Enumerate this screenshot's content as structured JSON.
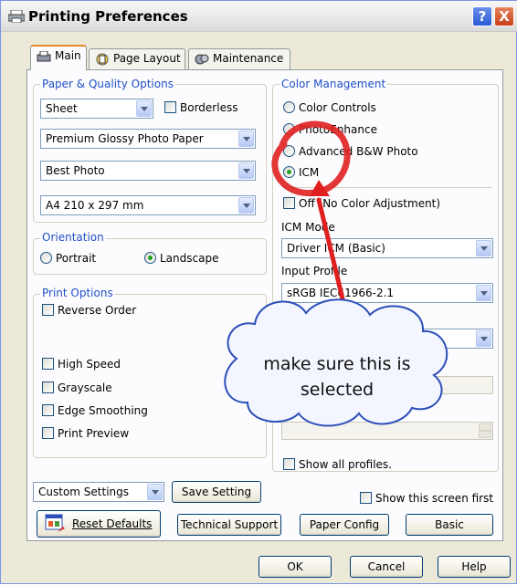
{
  "window": {
    "title": "Printing Preferences",
    "help_glyph": "?",
    "close_glyph": "X"
  },
  "tabs": [
    {
      "label": "Main",
      "icon": "printer-paper-icon",
      "active": true
    },
    {
      "label": "Page Layout",
      "icon": "page-layout-icon",
      "active": false
    },
    {
      "label": "Maintenance",
      "icon": "maintenance-icon",
      "active": false
    }
  ],
  "paper_quality": {
    "label": "Paper & Quality Options",
    "source": "Sheet",
    "borderless_label": "Borderless",
    "paper_type": "Premium Glossy Photo Paper",
    "quality": "Best Photo",
    "paper_size": "A4 210 x 297 mm"
  },
  "orientation": {
    "label": "Orientation",
    "portrait_label": "Portrait",
    "landscape_label": "Landscape",
    "selected": "Landscape"
  },
  "print_options": {
    "label": "Print Options",
    "reverse_order": "Reverse Order",
    "high_speed": "High Speed",
    "grayscale": "Grayscale",
    "edge_smoothing": "Edge Smoothing",
    "print_preview": "Print Preview"
  },
  "color_management": {
    "label": "Color Management",
    "options": [
      "Color Controls",
      "PhotoEnhance",
      "Advanced B&W Photo",
      "ICM"
    ],
    "selected": "ICM",
    "off_label": "Off (No Color Adjustment)",
    "icm_mode_label": "ICM Mode",
    "icm_mode_value": "Driver ICM (Basic)",
    "input_profile_label": "Input Profile",
    "input_profile_value": "sRGB IEC61966-2.1",
    "show_all_profiles": "Show all profiles."
  },
  "custom_settings": {
    "value": "Custom Settings",
    "save_label": "Save Setting"
  },
  "buttons": {
    "reset_defaults": "Reset Defaults",
    "technical_support": "Technical Support",
    "paper_config": "Paper Config",
    "basic": "Basic",
    "show_first": "Show this screen first"
  },
  "footer": {
    "ok": "OK",
    "cancel": "Cancel",
    "help": "Help"
  },
  "annotation": {
    "text": "make sure this is selected",
    "line1": "make sure this is",
    "line2": "selected",
    "circle_color": "#e02020",
    "arrow_color": "#e02020",
    "cloud_fill": "#f4f6ff",
    "cloud_stroke": "#2b4fb8"
  }
}
